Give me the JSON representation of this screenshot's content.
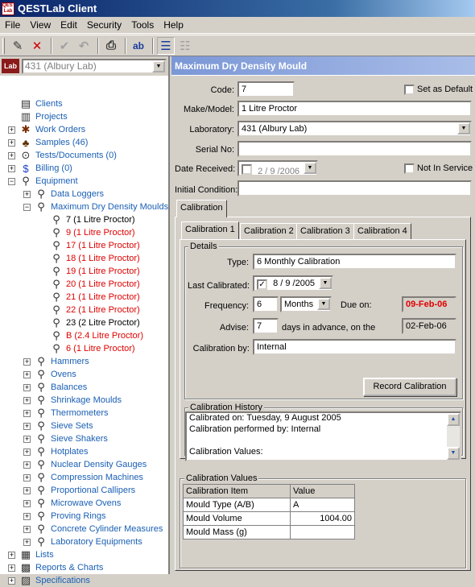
{
  "app": {
    "title": "QESTLab Client",
    "icon_text": "QEST Lab"
  },
  "menu": [
    "File",
    "View",
    "Edit",
    "Security",
    "Tools",
    "Help"
  ],
  "toolbar": [
    "new-record-icon",
    "delete-icon",
    "confirm-icon",
    "undo-icon",
    "print-icon",
    "spellcheck-icon",
    "tree-view-icon",
    "list-view-icon"
  ],
  "lab_selector": {
    "icon_text": "Lab",
    "value": "431 (Albury Lab)"
  },
  "tree": [
    {
      "label": "Clients",
      "icon": "clients-icon",
      "level": 1
    },
    {
      "label": "Projects",
      "icon": "projects-icon",
      "level": 1
    },
    {
      "label": "Work Orders",
      "icon": "work-orders-icon",
      "level": 0
    },
    {
      "label": "Samples (46)",
      "icon": "samples-icon",
      "level": 0
    },
    {
      "label": "Tests/Documents (0)",
      "icon": "tests-icon",
      "level": 0
    },
    {
      "label": "Billing (0)",
      "icon": "billing-icon",
      "level": 0
    },
    {
      "label": "Equipment",
      "icon": "equipment-icon",
      "level": 0
    },
    {
      "label": "Data Loggers",
      "icon": "equipment-icon",
      "level": 2
    },
    {
      "label": "Maximum Dry Density Moulds",
      "icon": "equipment-icon",
      "level": 2
    },
    {
      "label": "7 (1 Litre Proctor)",
      "icon": "equipment-icon",
      "level": 3,
      "color": "blk"
    },
    {
      "label": "9 (1 Litre Proctor)",
      "icon": "equipment-icon",
      "level": 3,
      "color": "red"
    },
    {
      "label": "17 (1 Litre Proctor)",
      "icon": "equipment-icon",
      "level": 3,
      "color": "red"
    },
    {
      "label": "18 (1 Litre Proctor)",
      "icon": "equipment-icon",
      "level": 3,
      "color": "red"
    },
    {
      "label": "19 (1 Litre Proctor)",
      "icon": "equipment-icon",
      "level": 3,
      "color": "red"
    },
    {
      "label": "20 (1 Litre Proctor)",
      "icon": "equipment-icon",
      "level": 3,
      "color": "red"
    },
    {
      "label": "21 (1 Litre Proctor)",
      "icon": "equipment-icon",
      "level": 3,
      "color": "red"
    },
    {
      "label": "22 (1 Litre Proctor)",
      "icon": "equipment-icon",
      "level": 3,
      "color": "red"
    },
    {
      "label": "23 (2 Litre Proctor)",
      "icon": "equipment-icon",
      "level": 3,
      "color": "blk"
    },
    {
      "label": "B (2.4 Litre Proctor)",
      "icon": "equipment-icon",
      "level": 3,
      "color": "red"
    },
    {
      "label": "6 (1 Litre Proctor)",
      "icon": "equipment-icon",
      "level": 3,
      "color": "red"
    },
    {
      "label": "Hammers",
      "icon": "equipment-icon",
      "level": 2
    },
    {
      "label": "Ovens",
      "icon": "equipment-icon",
      "level": 2
    },
    {
      "label": "Balances",
      "icon": "equipment-icon",
      "level": 2
    },
    {
      "label": "Shrinkage Moulds",
      "icon": "equipment-icon",
      "level": 2
    },
    {
      "label": "Thermometers",
      "icon": "equipment-icon",
      "level": 2
    },
    {
      "label": "Sieve Sets",
      "icon": "equipment-icon",
      "level": 2
    },
    {
      "label": "Sieve Shakers",
      "icon": "equipment-icon",
      "level": 2
    },
    {
      "label": "Hotplates",
      "icon": "equipment-icon",
      "level": 2
    },
    {
      "label": "Nuclear Density Gauges",
      "icon": "equipment-icon",
      "level": 2
    },
    {
      "label": "Compression Machines",
      "icon": "equipment-icon",
      "level": 2
    },
    {
      "label": "Proportional Callipers",
      "icon": "equipment-icon",
      "level": 2
    },
    {
      "label": "Microwave Ovens",
      "icon": "equipment-icon",
      "level": 2
    },
    {
      "label": "Proving Rings",
      "icon": "equipment-icon",
      "level": 2
    },
    {
      "label": "Concrete Cylinder Measures",
      "icon": "equipment-icon",
      "level": 2
    },
    {
      "label": "Laboratory Equipments",
      "icon": "equipment-icon",
      "level": 2
    },
    {
      "label": "Lists",
      "icon": "lists-icon",
      "level": 0
    },
    {
      "label": "Reports & Charts",
      "icon": "reports-icon",
      "level": 0
    },
    {
      "label": "Specifications",
      "icon": "specifications-icon",
      "level": 0
    }
  ],
  "form": {
    "title": "Maximum Dry Density Mould",
    "code_label": "Code:",
    "code": "7",
    "set_default_label": "Set as Default",
    "make_label": "Make/Model:",
    "make": "1 Litre Proctor",
    "lab_label": "Laboratory:",
    "lab": "431 (Albury Lab)",
    "serial_label": "Serial No:",
    "serial": "",
    "date_received_label": "Date Received:",
    "date_received": "2 / 9 /2006",
    "not_in_service_label": "Not In Service",
    "condition_label": "Initial Condition:",
    "condition": ""
  },
  "outer_tab": "Calibration",
  "cal_tabs": [
    "Calibration 1",
    "Calibration 2",
    "Calibration 3",
    "Calibration 4"
  ],
  "details": {
    "group_label": "Details",
    "type_label": "Type:",
    "type": "6 Monthly Calibration",
    "last_label": "Last Calibrated:",
    "last": "8 / 9 /2005",
    "freq_label": "Frequency:",
    "freq": "6",
    "freq_unit": "Months",
    "due_label": "Due on:",
    "due": "09-Feb-06",
    "advise_label": "Advise:",
    "advise": "7",
    "advise_text": "days in advance, on the",
    "advise_date": "02-Feb-06",
    "by_label": "Calibration by:",
    "by": "Internal",
    "record_button": "Record Calibration"
  },
  "history": {
    "group_label": "Calibration History",
    "lines": [
      "Calibrated on: Tuesday, 9 August 2005",
      "Calibration performed by: Internal",
      "",
      "Calibration Values:"
    ]
  },
  "values": {
    "group_label": "Calibration Values",
    "headers": [
      "Calibration Item",
      "Value"
    ],
    "rows": [
      [
        "Mould Type (A/B)",
        "A"
      ],
      [
        "Mould Volume",
        "1004.00"
      ],
      [
        "Mould Mass (g)",
        ""
      ]
    ]
  },
  "colors": {
    "due_text": "#e00000",
    "header_gradient_start": "#7b97d6"
  }
}
